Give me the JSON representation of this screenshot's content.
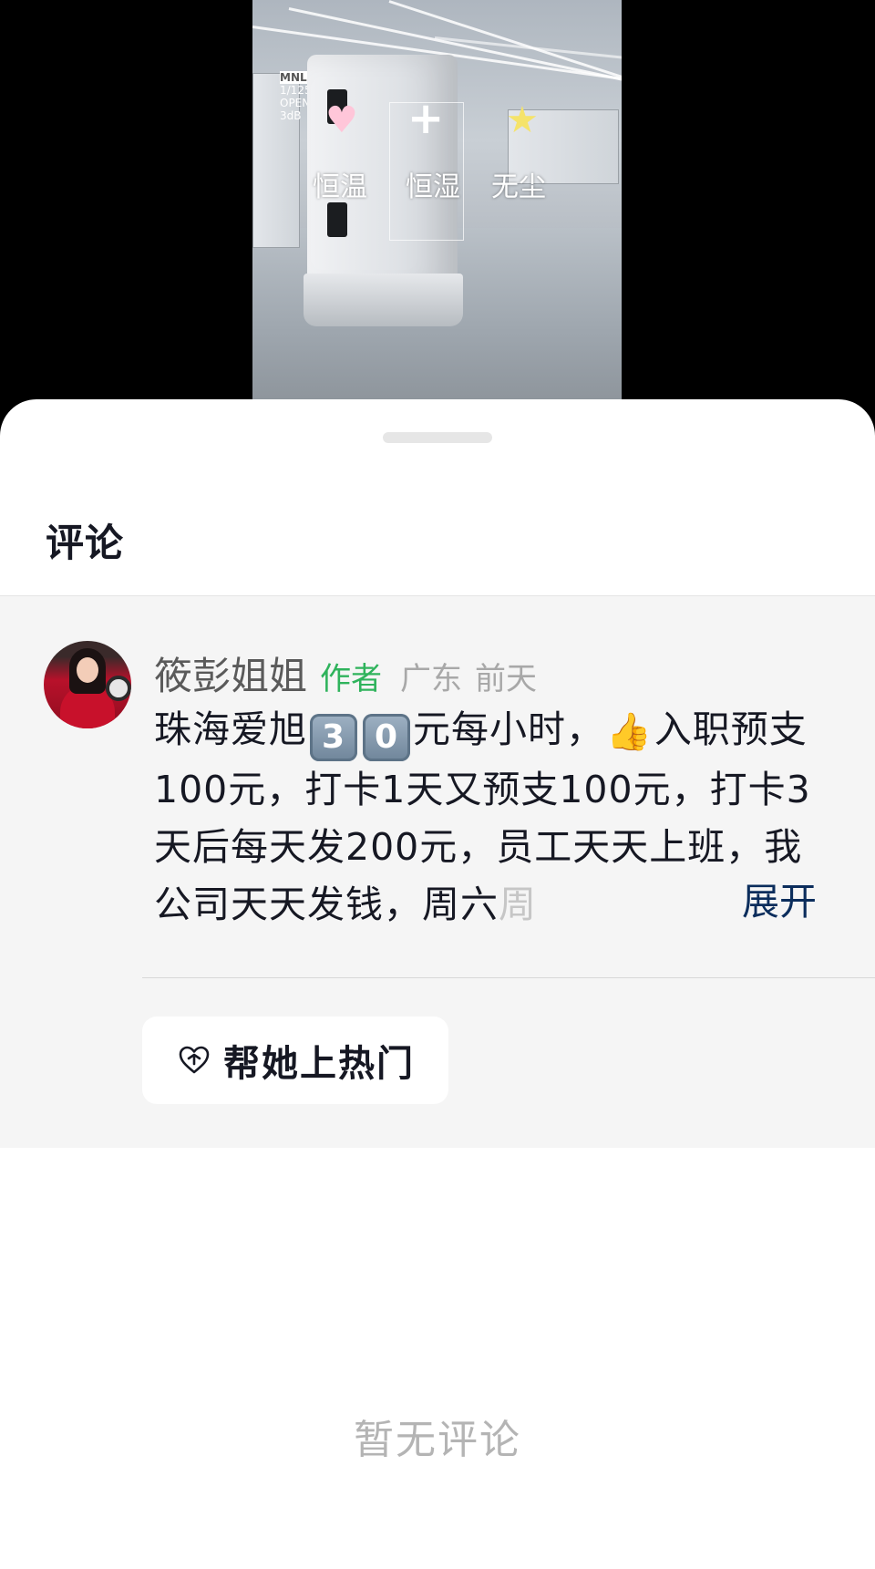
{
  "video": {
    "overlay_labels": [
      "恒温",
      "恒湿",
      "无尘"
    ],
    "overlay_icons": [
      "heart-icon",
      "plus-icon",
      "star-icon"
    ],
    "sign_text": [
      "MNL",
      "1/125",
      "OPEN",
      "3dB"
    ]
  },
  "sheet": {
    "title": "评论"
  },
  "comment": {
    "username": "筱彭姐姐",
    "author_tag": "作者",
    "location": "广东",
    "time": "前天",
    "text_parts": {
      "lead": "珠海爱旭",
      "digit1": "3",
      "digit2": "0",
      "after_digits": "元每小时，",
      "thumb": "👍",
      "after_thumb": "入职预支100元，打卡1天又预支100元，打卡3天后每天发200元，员工天天上班，我公司天天发钱，周六",
      "faded": "周"
    },
    "expand_label": "展开",
    "action_button": "帮她上热门"
  },
  "empty_state": "暂无评论",
  "colors": {
    "author_green": "#2fb35c",
    "expand_blue": "#0b2d5c",
    "panel_bg": "#f5f5f5"
  }
}
